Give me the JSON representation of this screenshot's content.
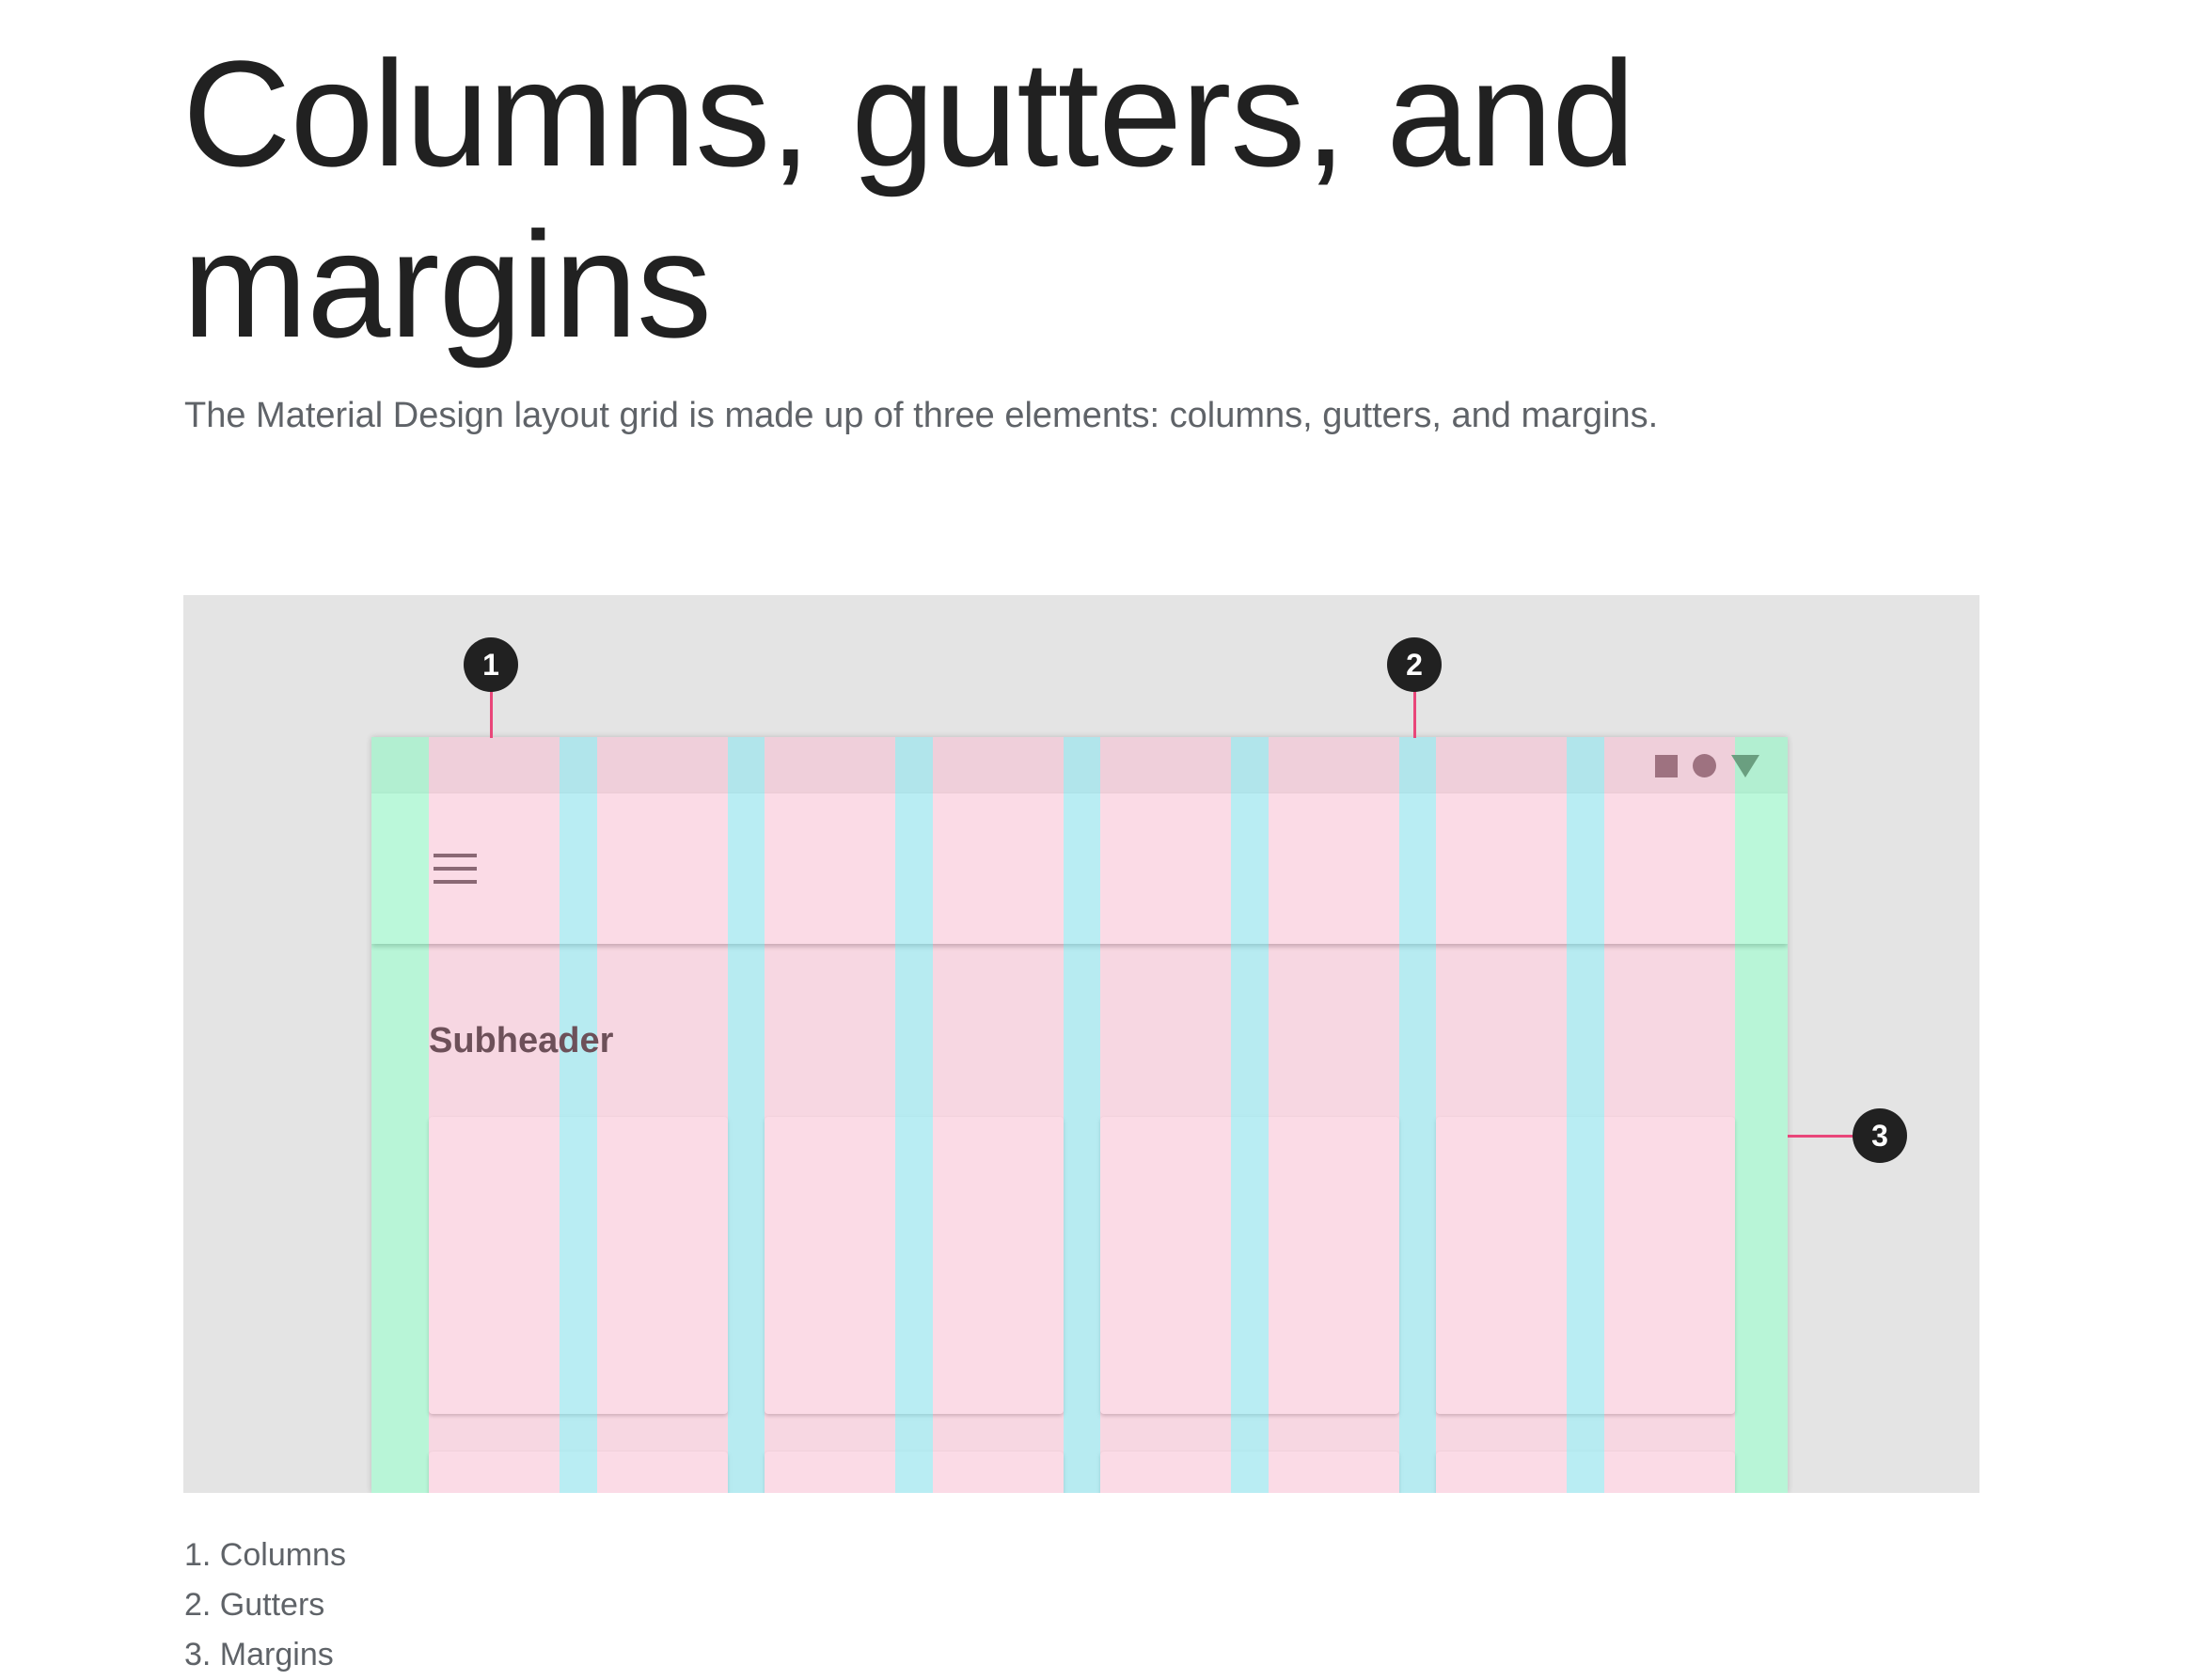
{
  "page": {
    "title": "Columns, gutters, and margins",
    "intro": "The Material Design layout grid is made up of three elements: columns, gutters, and margins."
  },
  "figure": {
    "subheader": "Subheader",
    "status_icons": [
      "square-icon",
      "circle-icon",
      "triangle-icon"
    ],
    "app_bar_icon": "menu-icon",
    "callouts": [
      "1",
      "2",
      "3"
    ],
    "colors": {
      "background": "#e4e4e4",
      "margin_overlay": "#69f0ae",
      "column_overlay": "#f48fb1",
      "gutter_overlay": "#80deea",
      "leader_line": "#e9467a",
      "callout_badge": "#212121"
    }
  },
  "legend": [
    "1. Columns",
    "2. Gutters",
    "3. Margins"
  ]
}
